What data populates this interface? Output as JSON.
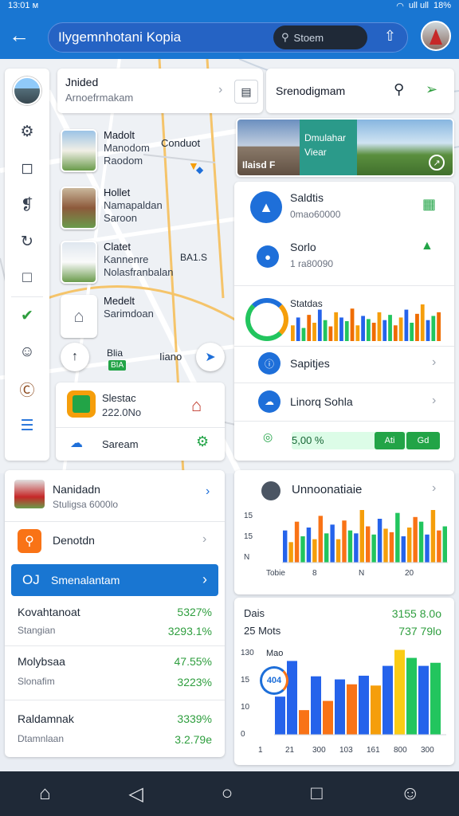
{
  "status": {
    "time": "13:01 ᴍ",
    "battery": "18%",
    "signal": "ull ull"
  },
  "appbar": {
    "title": "Ilygemnhotani Kopia",
    "search_placeholder": "Stoem",
    "back_icon": "arrow-left-icon",
    "share_icon": "share-icon"
  },
  "search_card": {
    "title": "Jnided",
    "subtitle": "Arnoefrmakam"
  },
  "right_search": {
    "label": "Srenodigmam"
  },
  "photo_banner": {
    "title": "Dmulahar",
    "subtitle": "Viear",
    "caption": "Ilaisd F"
  },
  "places": [
    {
      "name": "Madolt",
      "sub1": "Manodom",
      "sub2": "Raodom"
    },
    {
      "name": "Hollet",
      "sub1": "Namapaldan",
      "sub2": "Saroon"
    },
    {
      "name": "Clatet",
      "sub1": "Kannenre",
      "sub2": "Nolasfranbalan"
    },
    {
      "name": "Medelt",
      "sub1": "Sarimdoan",
      "sub2": ""
    }
  ],
  "map_labels": {
    "label_a": "Conduot",
    "label_b": "BA1.S",
    "label_c": "Blia",
    "label_d": "Iiano",
    "green_badge": "BIA"
  },
  "stats_card": {
    "item1": {
      "title": "Saldtis",
      "sub": "0mao60000"
    },
    "item2": {
      "title": "Sorlo",
      "sub": "1 ra80090"
    },
    "chart_title": "Statdas",
    "row1": "Sapitjes",
    "row2": "Linorq Sohla",
    "progress_label": "5,00 %",
    "progress_btn1": "Ati",
    "progress_btn2": "Gd"
  },
  "left_mini": {
    "title": "Slestac",
    "value": "222.0No",
    "row_label": "Saream"
  },
  "left_panel": {
    "header_name": "Nanidadn",
    "header_sub": "Stuligsa 6000lo",
    "row_label": "Denotdn",
    "highlight": {
      "icon_text": "OJ",
      "label": "Smenalantam"
    },
    "metrics": [
      {
        "title": "Kovahtanoat",
        "sub": "Stangian",
        "pct1": "5327%",
        "pct2": "3293.1%"
      },
      {
        "title": "Molybsaa",
        "sub": "Slonafim",
        "pct1": "47.55%",
        "pct2": "3223%"
      },
      {
        "title": "Raldamnak",
        "sub": "Dtamnlaan",
        "pct1": "3339%",
        "pct2": "3.2.79e"
      }
    ]
  },
  "right_chart1": {
    "title": "Unnoonatiaie",
    "yticks": [
      "15",
      "15",
      "N"
    ],
    "xticks": [
      "Tobie",
      "8",
      "N",
      "20"
    ]
  },
  "right_chart2": {
    "label1": "Dais",
    "label2": "25 Mots",
    "value1": "3155 8.0o",
    "value2": "737 79lo",
    "ytop_label": "Mao",
    "badge": "404"
  },
  "nav": {
    "home_icon": "home-icon",
    "back_icon": "triangle-back-icon",
    "circle_icon": "circle-home-icon",
    "square_icon": "square-recents-icon",
    "user_icon": "user-icon"
  },
  "chart_data": [
    {
      "type": "bar",
      "title": "Statdas",
      "values": [
        30,
        45,
        25,
        50,
        35,
        60,
        40,
        28,
        55,
        45,
        38,
        62,
        30,
        48,
        42,
        35,
        55,
        40,
        50,
        30,
        45,
        60,
        35,
        52,
        70,
        40,
        48,
        55
      ],
      "colors": [
        "#f59e0b",
        "#2563eb",
        "#22c55e",
        "#ef6c00"
      ]
    },
    {
      "type": "bar",
      "title": "Unnoonatiaie",
      "yticks": [
        "15",
        "15",
        "N"
      ],
      "xticks": [
        "Tobie",
        "8",
        "N",
        "20"
      ],
      "values": [
        55,
        35,
        70,
        45,
        60,
        40,
        80,
        50,
        65,
        40,
        72,
        55,
        50,
        90,
        62,
        48,
        75,
        58,
        52,
        85,
        45,
        60,
        78,
        70,
        48,
        90,
        55,
        62
      ],
      "colors": [
        "#2563eb",
        "#f59e0b",
        "#f97316",
        "#22c55e"
      ]
    },
    {
      "type": "bar",
      "title": "Dais",
      "yticks": [
        "130",
        "15",
        "10",
        "0"
      ],
      "xticks": [
        "1",
        "21",
        "300",
        "103",
        "161",
        "800",
        "300"
      ],
      "values": [
        62,
        120,
        40,
        95,
        55,
        90,
        82,
        96,
        80,
        112,
        138,
        125,
        112,
        117
      ],
      "colors": [
        "#2563eb",
        "#2563eb",
        "#f97316",
        "#2563eb",
        "#f97316",
        "#2563eb",
        "#f97316",
        "#2563eb",
        "#f59e0b",
        "#2563eb",
        "#facc15",
        "#22c55e",
        "#2563eb",
        "#22c55e"
      ]
    }
  ]
}
